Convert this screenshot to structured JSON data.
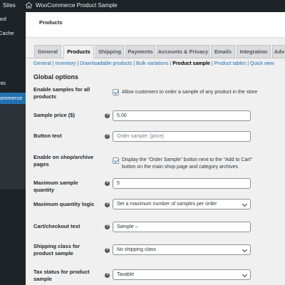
{
  "admin_bar": {
    "sites_label": "Sites",
    "site_title": "WooCommerce Product Sample"
  },
  "sidebar": {
    "items": [
      "ard",
      "Cache",
      "nts",
      "ommerce"
    ]
  },
  "header": {
    "title": "Products"
  },
  "tabs": [
    {
      "label": "General",
      "active": false
    },
    {
      "label": "Products",
      "active": true
    },
    {
      "label": "Shipping",
      "active": false
    },
    {
      "label": "Payments",
      "active": false
    },
    {
      "label": "Accounts & Privacy",
      "active": false
    },
    {
      "label": "Emails",
      "active": false
    },
    {
      "label": "Integration",
      "active": false
    },
    {
      "label": "Adv",
      "active": false
    }
  ],
  "subnav": {
    "items": [
      "General",
      "Inventory",
      "Downloadable products",
      "Bulk variations",
      "Product sample",
      "Product tables",
      "Quick view"
    ],
    "current": "Product sample"
  },
  "section_title": "Global options",
  "settings": {
    "enable_samples": {
      "label": "Enable samples for all products",
      "checkbox_text": "Allow customers to order a sample of any product in the store",
      "checked": true
    },
    "sample_price": {
      "label": "Sample price ($)",
      "value": "5.00"
    },
    "button_text": {
      "label": "Button text",
      "placeholder": "Order sample: {price}"
    },
    "enable_archive": {
      "label": "Enable on shop/archive pages",
      "checkbox_text": "Display the “Order Sample” button next to the “Add to Cart” button on the main shop page and category archives",
      "checked": true
    },
    "max_quantity": {
      "label": "Maximum sample quantity",
      "value": "5"
    },
    "max_logic": {
      "label": "Maximum quantity logic",
      "value": "Set a maximum number of samples per order"
    },
    "cart_text": {
      "label": "Cart/checkout text",
      "value": "Sample –"
    },
    "shipping_class": {
      "label": "Shipping class for product sample",
      "value": "No shipping class"
    },
    "tax_status": {
      "label": "Tax status for product sample",
      "value": "Taxable"
    }
  },
  "help_glyph": "?",
  "colors": {
    "admin_bar": "#1d2327",
    "accent": "#2271b1",
    "page_bg": "#f0f0f1"
  }
}
